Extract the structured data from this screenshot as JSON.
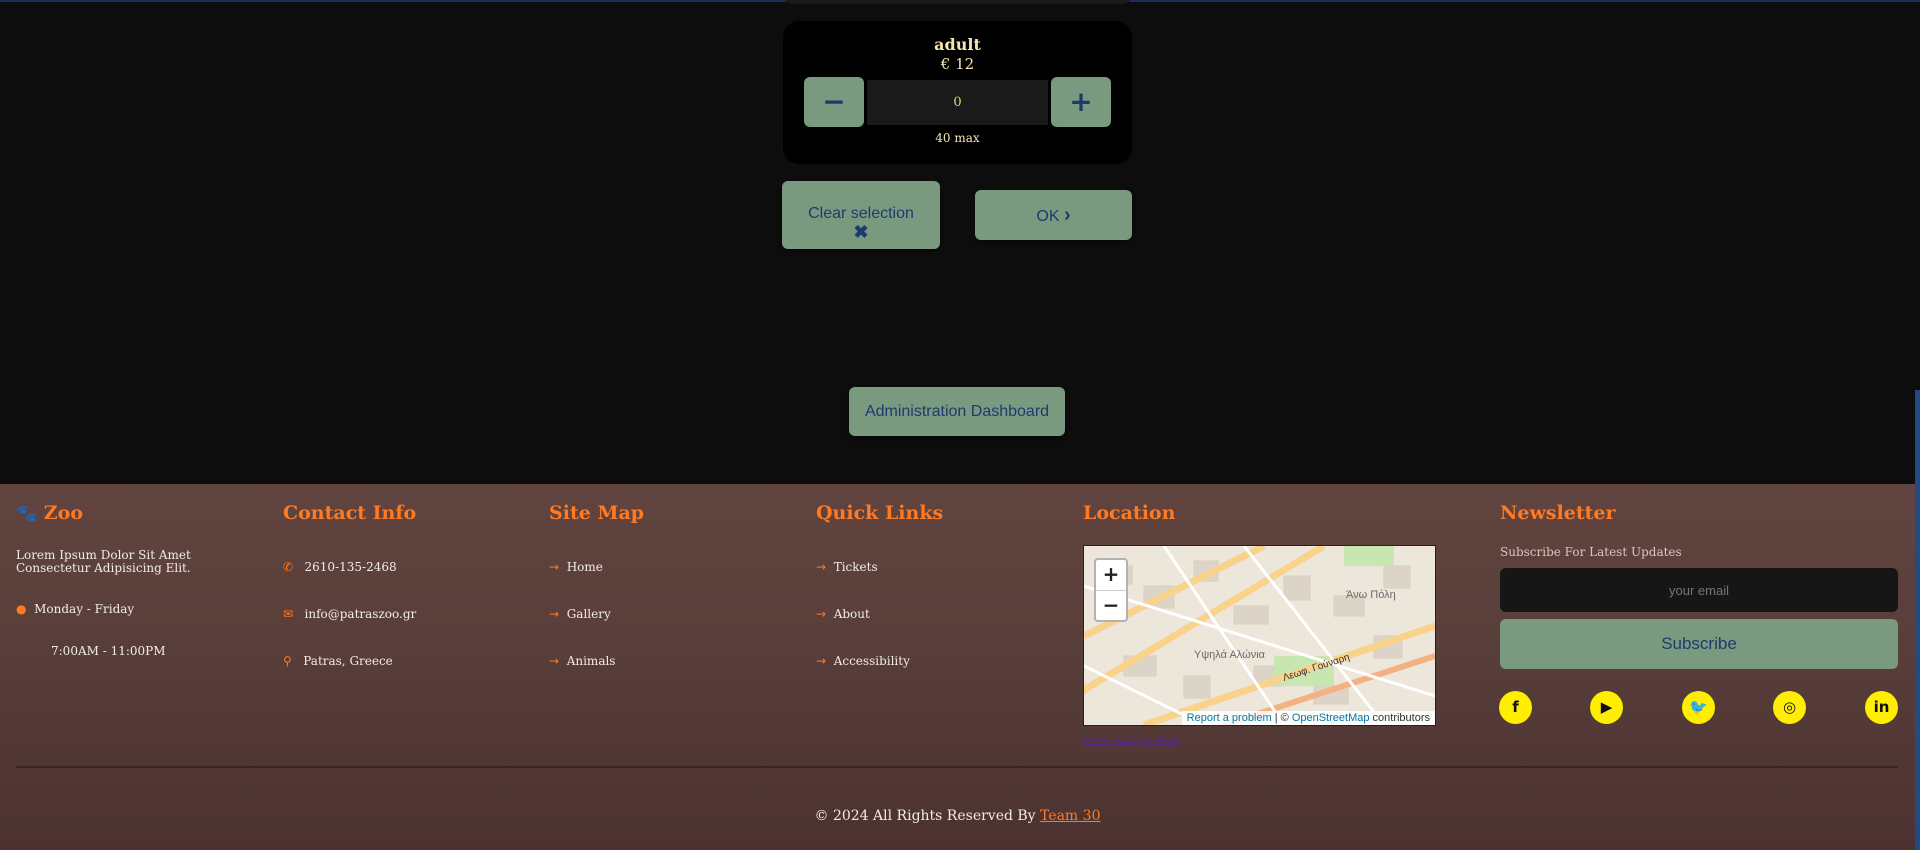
{
  "ticket": {
    "name": "adult",
    "price": "€ 12",
    "minus": "−",
    "plus": "+",
    "quantity": "0",
    "max": "40 max"
  },
  "actions": {
    "clear_label": "Clear selection",
    "clear_icon": "✖",
    "ok_label": "OK",
    "ok_icon": "›",
    "admin_label": "Administration Dashboard"
  },
  "footer": {
    "brand": {
      "icon": "paw-icon",
      "glyph": "🐾",
      "title": "Zoo",
      "text": "Lorem Ipsum Dolor Sit Amet Consectetur Adipisicing Elit.",
      "days": "Monday - Friday",
      "hours": "7:00AM - 11:00PM"
    },
    "contact": {
      "title": "Contact Info",
      "phone": "2610-135-2468",
      "email": "info@patraszoo.gr",
      "address": "Patras, Greece"
    },
    "sitemap": {
      "title": "Site Map",
      "items": [
        "Home",
        "Gallery",
        "Animals"
      ]
    },
    "quicklinks": {
      "title": "Quick Links",
      "items": [
        "Tickets",
        "About",
        "Accessibility"
      ]
    },
    "location": {
      "title": "Location",
      "zoom_in": "+",
      "zoom_out": "−",
      "report": "Report a problem",
      "sep": " | © ",
      "osm": "OpenStreetMap",
      "contributors": " contributors",
      "larger": "View Larger Map",
      "labels": [
        "Άνω Πόλη",
        "Υψηλά Αλώνια",
        "Λεωφ. Γούναρη"
      ]
    },
    "newsletter": {
      "title": "Newsletter",
      "subtitle": "Subscribe For Latest Updates",
      "placeholder": "your email",
      "button": "Subscribe"
    },
    "social": [
      "facebook-icon",
      "youtube-icon",
      "twitter-icon",
      "instagram-icon",
      "linkedin-icon"
    ],
    "copyright": "© 2024 All Rights Reserved By ",
    "team": "Team 30"
  },
  "colors": {
    "accent": "#ff7a22",
    "button": "#7a9a80",
    "button_text": "#1d3a70",
    "social": "#ffee00"
  }
}
